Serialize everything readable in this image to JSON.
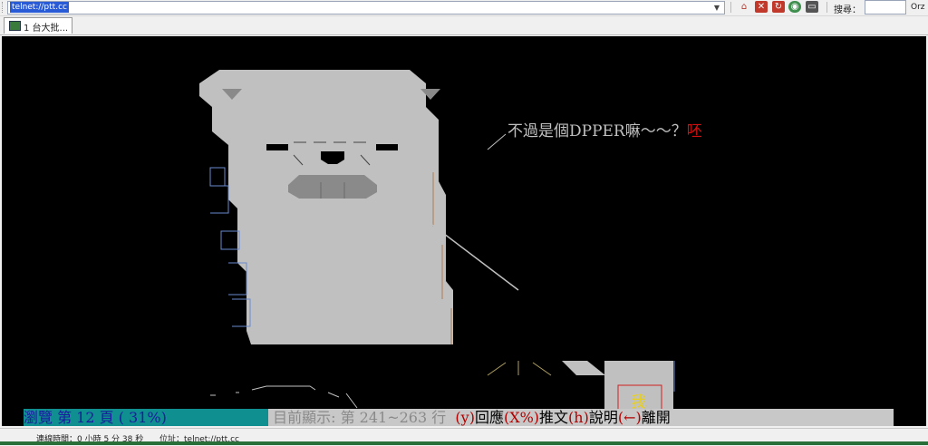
{
  "toolbar": {
    "address": "telnet://ptt.cc",
    "search_label": "搜尋：",
    "orz_label": "Orz"
  },
  "tabs": [
    {
      "label": "1 台大批..."
    }
  ],
  "terminal": {
    "speech_text": "不過是個DPPER嘛～～？",
    "speech_red": "呸",
    "box_char": "我"
  },
  "statusline": {
    "browse": "瀏覽 第 12 頁 ( 31%)",
    "current_display": "目前顯示: 第 241~263 行",
    "y_key": "(y)",
    "reply": "回應",
    "x_key": "(X%)",
    "push": "推文",
    "h_key": "(h)",
    "help": "說明",
    "left_key": "(←)",
    "leave": "離開"
  },
  "bottombar": {
    "connect_time": "連線時間：0 小時 5 分 38 秒",
    "address": "位址：telnet://ptt.cc"
  },
  "colors": {
    "terminal_bg": "#000000",
    "bear": "#c0c0c0",
    "status_cyan": "#0f8f8f",
    "status_gray": "#c8c8c8",
    "red": "#d01010"
  }
}
